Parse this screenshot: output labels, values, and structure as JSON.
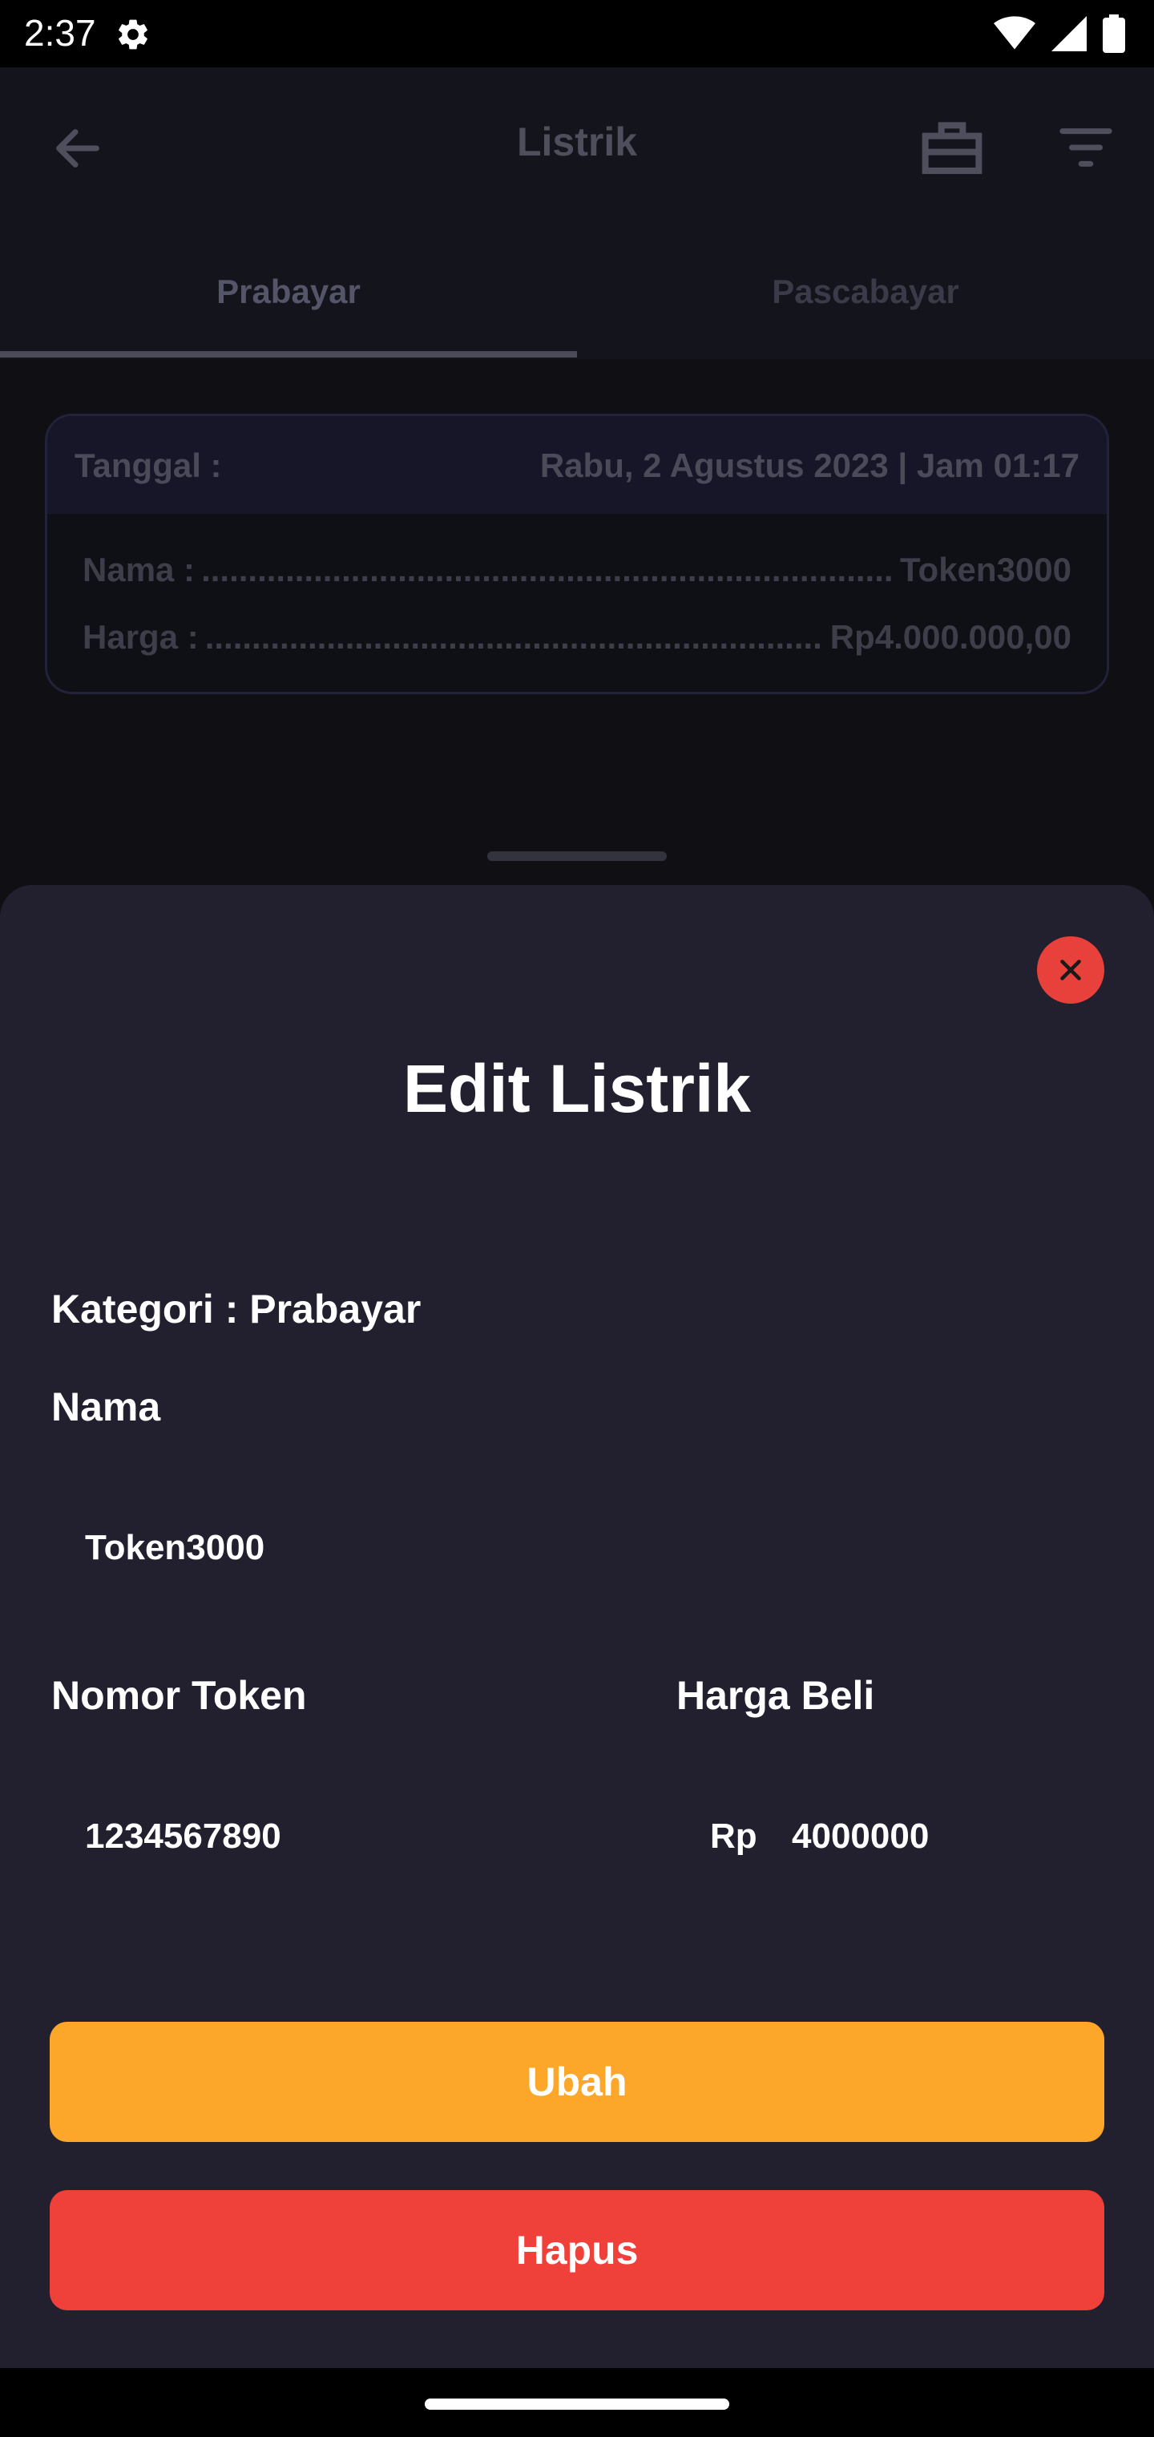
{
  "status_bar": {
    "time": "2:37"
  },
  "app_bar": {
    "title": "Listrik"
  },
  "tabs": [
    {
      "label": "Prabayar",
      "active": true
    },
    {
      "label": "Pascabayar",
      "active": false
    }
  ],
  "card": {
    "date_label": "Tanggal :",
    "date_value": "Rabu, 2 Agustus 2023 | Jam 01:17",
    "name_label": "Nama :",
    "name_value": "Token3000",
    "price_label": "Harga :",
    "price_value": "Rp4.000.000,00",
    "dots": ".................................................................................................................."
  },
  "sheet": {
    "title": "Edit Listrik",
    "category": "Kategori : Prabayar",
    "name_label": "Nama",
    "name_value": "Token3000",
    "token_label": "Nomor Token",
    "token_value": "1234567890",
    "price_label": "Harga Beli",
    "price_prefix": "Rp",
    "price_value": "4000000",
    "save_label": "Ubah",
    "delete_label": "Hapus"
  },
  "colors": {
    "accent_orange": "#fca72a",
    "danger_red": "#f0403a",
    "sheet_bg": "#22202f"
  }
}
